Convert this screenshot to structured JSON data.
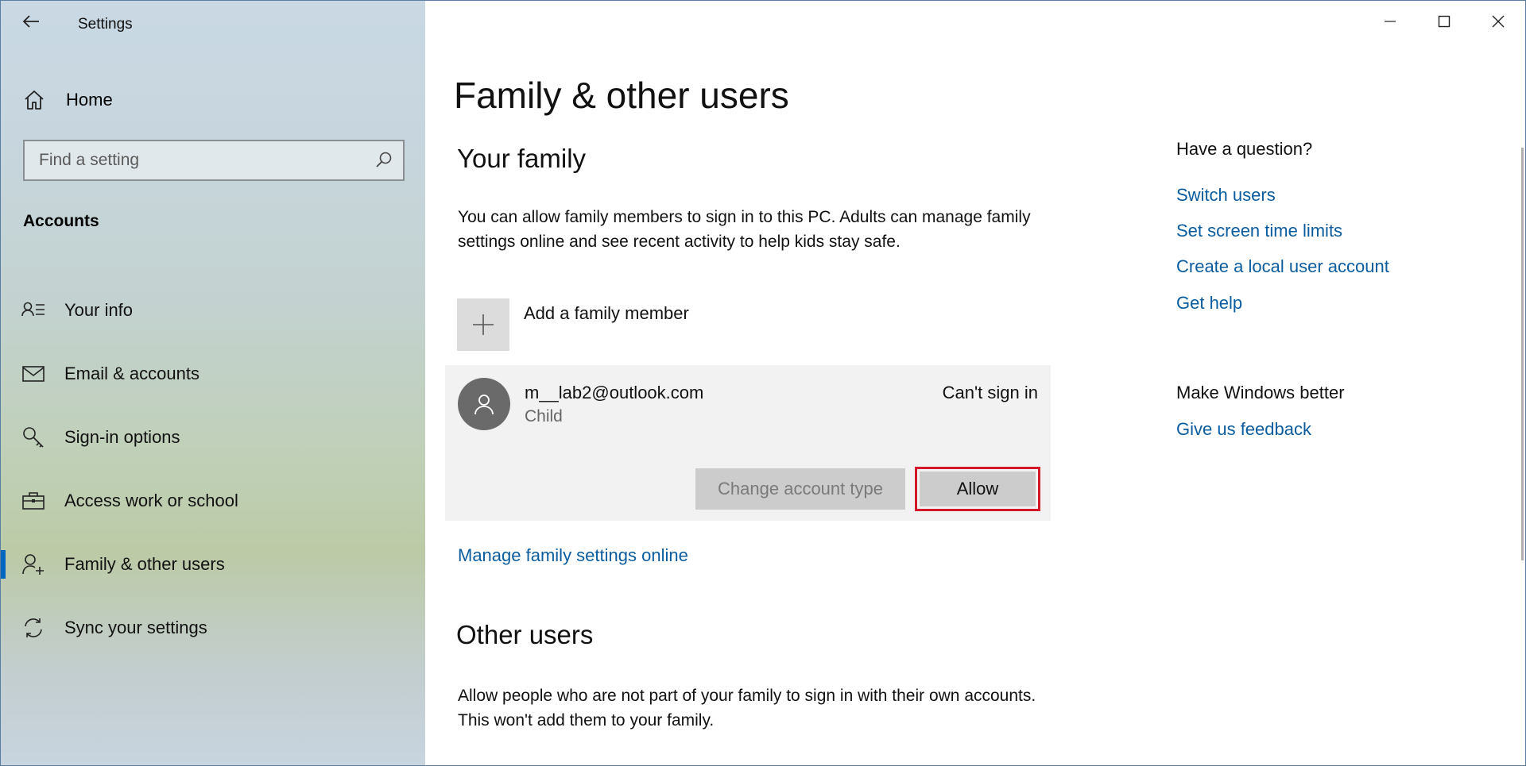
{
  "window": {
    "title": "Settings",
    "controls": {
      "minimize": "minimize-icon",
      "maximize": "maximize-icon",
      "close": "close-icon"
    }
  },
  "sidebar": {
    "home": "Home",
    "search_placeholder": "Find a setting",
    "section": "Accounts",
    "items": [
      {
        "label": "Your info",
        "icon": "person-list-icon"
      },
      {
        "label": "Email & accounts",
        "icon": "mail-icon"
      },
      {
        "label": "Sign-in options",
        "icon": "key-icon"
      },
      {
        "label": "Access work or school",
        "icon": "briefcase-icon"
      },
      {
        "label": "Family & other users",
        "icon": "person-add-icon",
        "active": true
      },
      {
        "label": "Sync your settings",
        "icon": "sync-icon"
      }
    ],
    "accent": "#0067c0"
  },
  "main": {
    "title": "Family & other users",
    "family": {
      "heading": "Your family",
      "description": "You can allow family members to sign in to this PC. Adults can manage family settings online and see recent activity to help kids stay safe.",
      "add_label": "Add a family member",
      "member": {
        "email": "m__lab2@outlook.com",
        "role": "Child",
        "status": "Can't sign in",
        "change_button": "Change account type",
        "allow_button": "Allow"
      },
      "manage_link": "Manage family settings online"
    },
    "other": {
      "heading": "Other users",
      "description": "Allow people who are not part of your family to sign in with their own accounts. This won't add them to your family."
    }
  },
  "aside": {
    "question_heading": "Have a question?",
    "links": [
      "Switch users",
      "Set screen time limits",
      "Create a local user account",
      "Get help"
    ],
    "better_heading": "Make Windows better",
    "feedback_link": "Give us feedback"
  }
}
